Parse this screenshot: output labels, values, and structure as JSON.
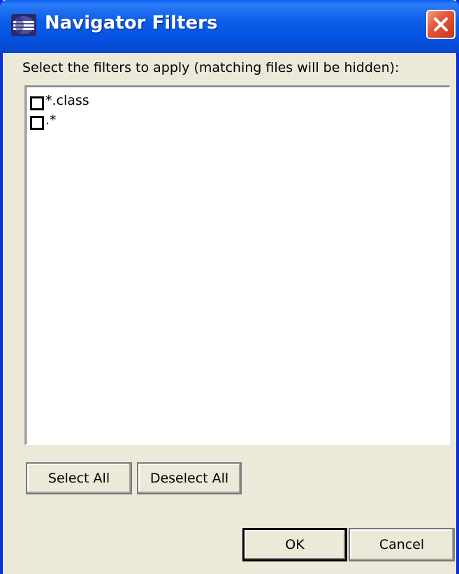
{
  "window": {
    "title": "Navigator Filters"
  },
  "dialog": {
    "instruction": "Select the filters to apply (matching files will be hidden):",
    "filters": [
      {
        "label": "*.class",
        "checked": false
      },
      {
        "label": ".*",
        "checked": false
      }
    ],
    "select_all_label": "Select All",
    "deselect_all_label": "Deselect All",
    "ok_label": "OK",
    "cancel_label": "Cancel"
  },
  "icons": {
    "app": "eclipse-app-icon",
    "close": "close-icon",
    "checkbox": "checkbox-icon"
  },
  "colors": {
    "titlebar": "#0b5ee8",
    "close_button": "#e2583a",
    "dialog_background": "#ece9d8"
  }
}
